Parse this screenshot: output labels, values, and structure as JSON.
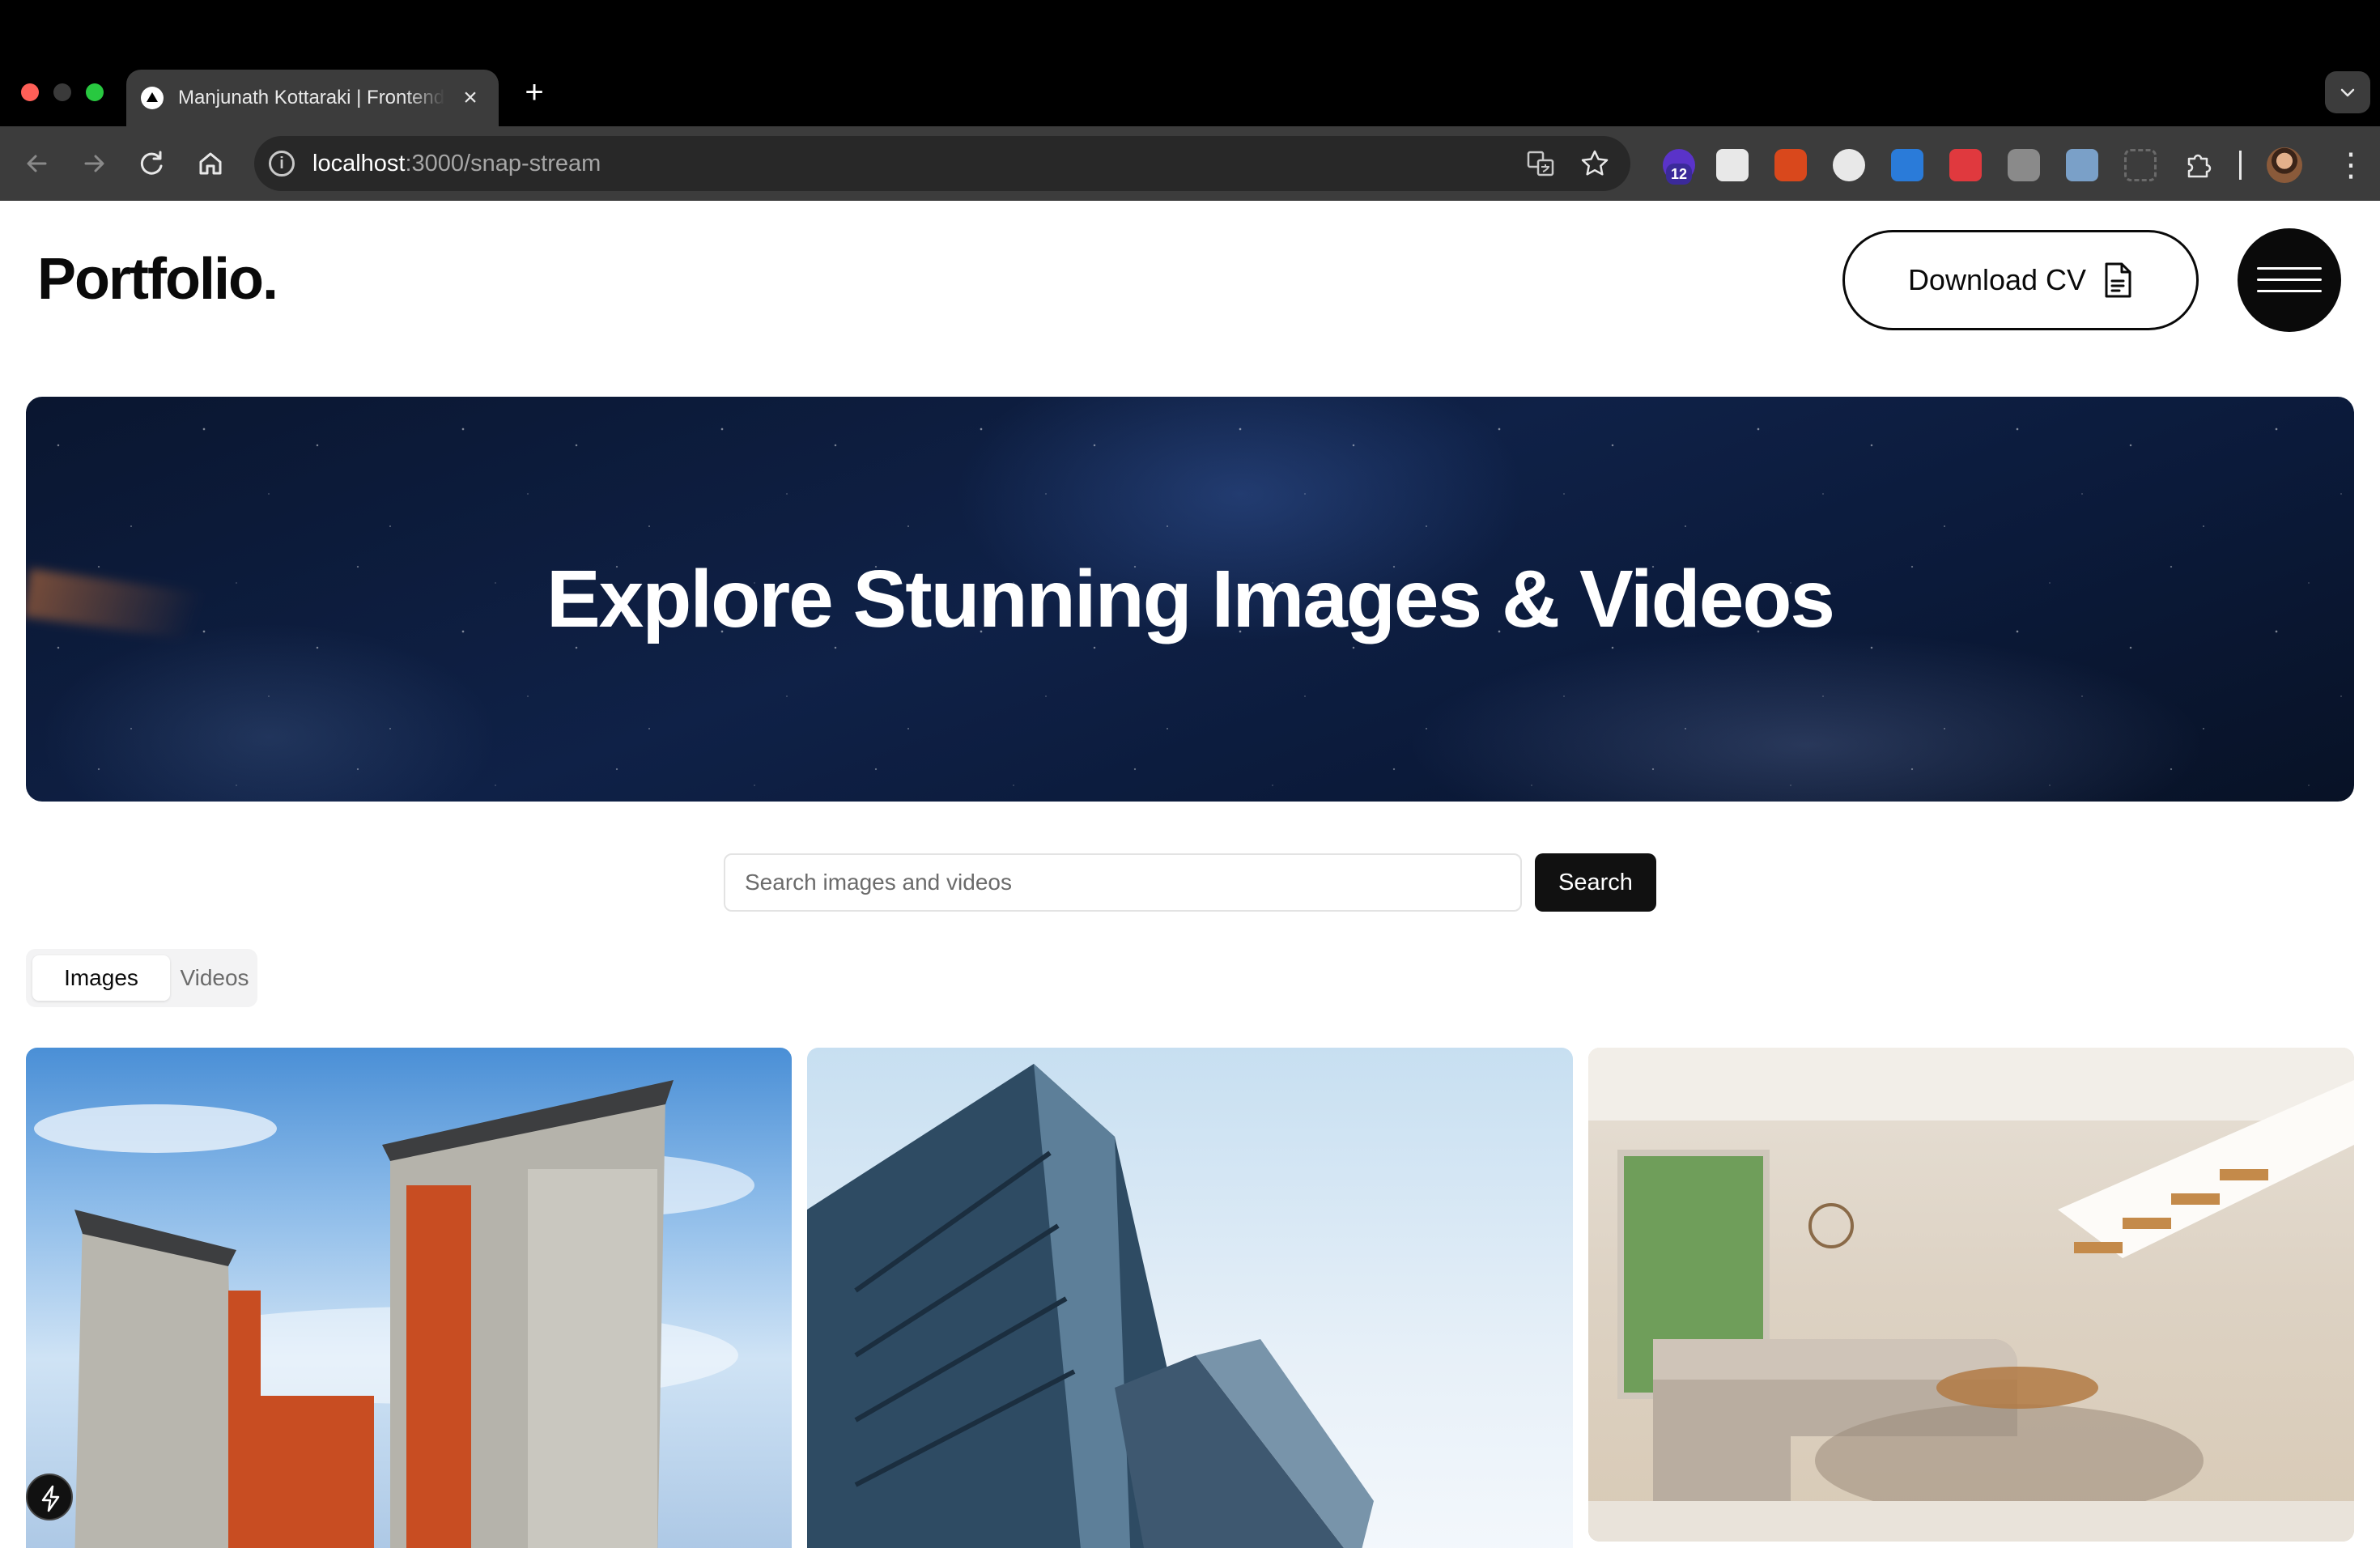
{
  "browser": {
    "tab_title": "Manjunath Kottaraki | Frontend Developer",
    "new_tab_symbol": "+",
    "close_symbol": "×",
    "url_host": "localhost",
    "url_path": ":3000/snap-stream",
    "extension_badge": "12",
    "kebab_symbol": "⋮"
  },
  "header": {
    "logo": "Portfolio.",
    "download_label": "Download CV"
  },
  "hero": {
    "title": "Explore Stunning Images & Videos"
  },
  "search": {
    "placeholder": "Search images and videos",
    "value": "",
    "button_label": "Search"
  },
  "media_tabs": {
    "items": [
      "Images",
      "Videos"
    ],
    "active": "Images"
  },
  "gallery": {
    "images": [
      "apartment-building-orange",
      "glass-office-tower",
      "living-room-interior"
    ]
  },
  "colors": {
    "accent": "#0a0a0a",
    "hero_bg": "#0f2147",
    "search_button": "#111111"
  }
}
